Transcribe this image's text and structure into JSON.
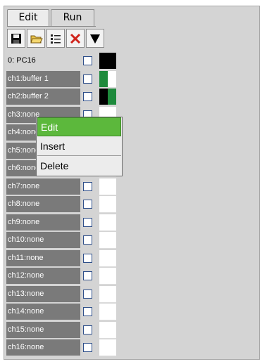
{
  "tabs": [
    {
      "label": "Edit",
      "active": true
    },
    {
      "label": "Run",
      "active": false
    }
  ],
  "toolbar": [
    {
      "icon": "save-icon"
    },
    {
      "icon": "open-folder-icon"
    },
    {
      "icon": "list-icon"
    },
    {
      "icon": "delete-x-icon"
    },
    {
      "icon": "dropdown-arrow-icon"
    }
  ],
  "channels": [
    {
      "label": "0: PC16",
      "checked": false,
      "swatch": [
        "#000000",
        "#000000"
      ]
    },
    {
      "label": "ch1:buffer 1",
      "checked": false,
      "swatch": [
        "#1e8a3c",
        "#ffffff"
      ]
    },
    {
      "label": "ch2:buffer 2",
      "checked": false,
      "swatch": [
        "#000000",
        "#1e8a3c"
      ]
    },
    {
      "label": "ch3:none",
      "checked": false,
      "swatch": [
        "#ffffff",
        "#ffffff"
      ]
    },
    {
      "label": "ch4:none",
      "checked": false,
      "swatch": [
        "#ffffff",
        "#ffffff"
      ]
    },
    {
      "label": "ch5:none",
      "checked": false,
      "swatch": [
        "#ffffff",
        "#ffffff"
      ]
    },
    {
      "label": "ch6:none",
      "checked": false,
      "swatch": [
        "#ffffff",
        "#ffffff"
      ]
    },
    {
      "label": "ch7:none",
      "checked": false,
      "swatch": [
        "#ffffff",
        "#ffffff"
      ]
    },
    {
      "label": "ch8:none",
      "checked": false,
      "swatch": [
        "#ffffff",
        "#ffffff"
      ]
    },
    {
      "label": "ch9:none",
      "checked": false,
      "swatch": [
        "#ffffff",
        "#ffffff"
      ]
    },
    {
      "label": "ch10:none",
      "checked": false,
      "swatch": [
        "#ffffff",
        "#ffffff"
      ]
    },
    {
      "label": "ch11:none",
      "checked": false,
      "swatch": [
        "#ffffff",
        "#ffffff"
      ]
    },
    {
      "label": "ch12:none",
      "checked": false,
      "swatch": [
        "#ffffff",
        "#ffffff"
      ]
    },
    {
      "label": "ch13:none",
      "checked": false,
      "swatch": [
        "#ffffff",
        "#ffffff"
      ]
    },
    {
      "label": "ch14:none",
      "checked": false,
      "swatch": [
        "#ffffff",
        "#ffffff"
      ]
    },
    {
      "label": "ch15:none",
      "checked": false,
      "swatch": [
        "#ffffff",
        "#ffffff"
      ]
    },
    {
      "label": "ch16:none",
      "checked": false,
      "swatch": [
        "#ffffff",
        "#ffffff"
      ]
    }
  ],
  "context_menu": {
    "items": [
      {
        "label": "Edit",
        "highlighted": true
      },
      {
        "label": "Insert",
        "highlighted": false
      },
      {
        "label": "Delete",
        "highlighted": false
      }
    ]
  },
  "colors": {
    "highlight": "#5cb83c",
    "channel_bg": "#7a7a7a",
    "panel_bg": "#d4d4d4"
  }
}
